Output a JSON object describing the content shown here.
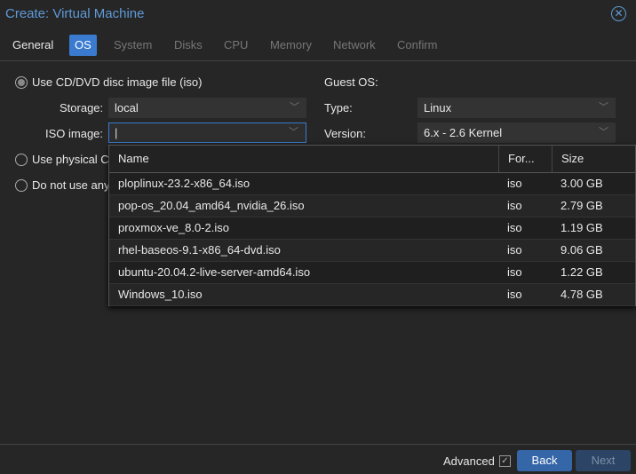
{
  "title": "Create: Virtual Machine",
  "tabs": [
    "General",
    "OS",
    "System",
    "Disks",
    "CPU",
    "Memory",
    "Network",
    "Confirm"
  ],
  "media": {
    "opt_iso": "Use CD/DVD disc image file (iso)",
    "opt_physical": "Use physical C",
    "opt_none": "Do not use any",
    "storage_label": "Storage:",
    "storage_value": "local",
    "iso_label": "ISO image:",
    "iso_value": ""
  },
  "guest": {
    "heading": "Guest OS:",
    "type_label": "Type:",
    "type_value": "Linux",
    "version_label": "Version:",
    "version_value": "6.x - 2.6 Kernel"
  },
  "iso_list": {
    "columns": [
      "Name",
      "For...",
      "Size"
    ],
    "rows": [
      {
        "name": "ploplinux-23.2-x86_64.iso",
        "format": "iso",
        "size": "3.00 GB"
      },
      {
        "name": "pop-os_20.04_amd64_nvidia_26.iso",
        "format": "iso",
        "size": "2.79 GB"
      },
      {
        "name": "proxmox-ve_8.0-2.iso",
        "format": "iso",
        "size": "1.19 GB"
      },
      {
        "name": "rhel-baseos-9.1-x86_64-dvd.iso",
        "format": "iso",
        "size": "9.06 GB"
      },
      {
        "name": "ubuntu-20.04.2-live-server-amd64.iso",
        "format": "iso",
        "size": "1.22 GB"
      },
      {
        "name": "Windows_10.iso",
        "format": "iso",
        "size": "4.78 GB"
      }
    ]
  },
  "footer": {
    "advanced": "Advanced",
    "back": "Back",
    "next": "Next"
  }
}
